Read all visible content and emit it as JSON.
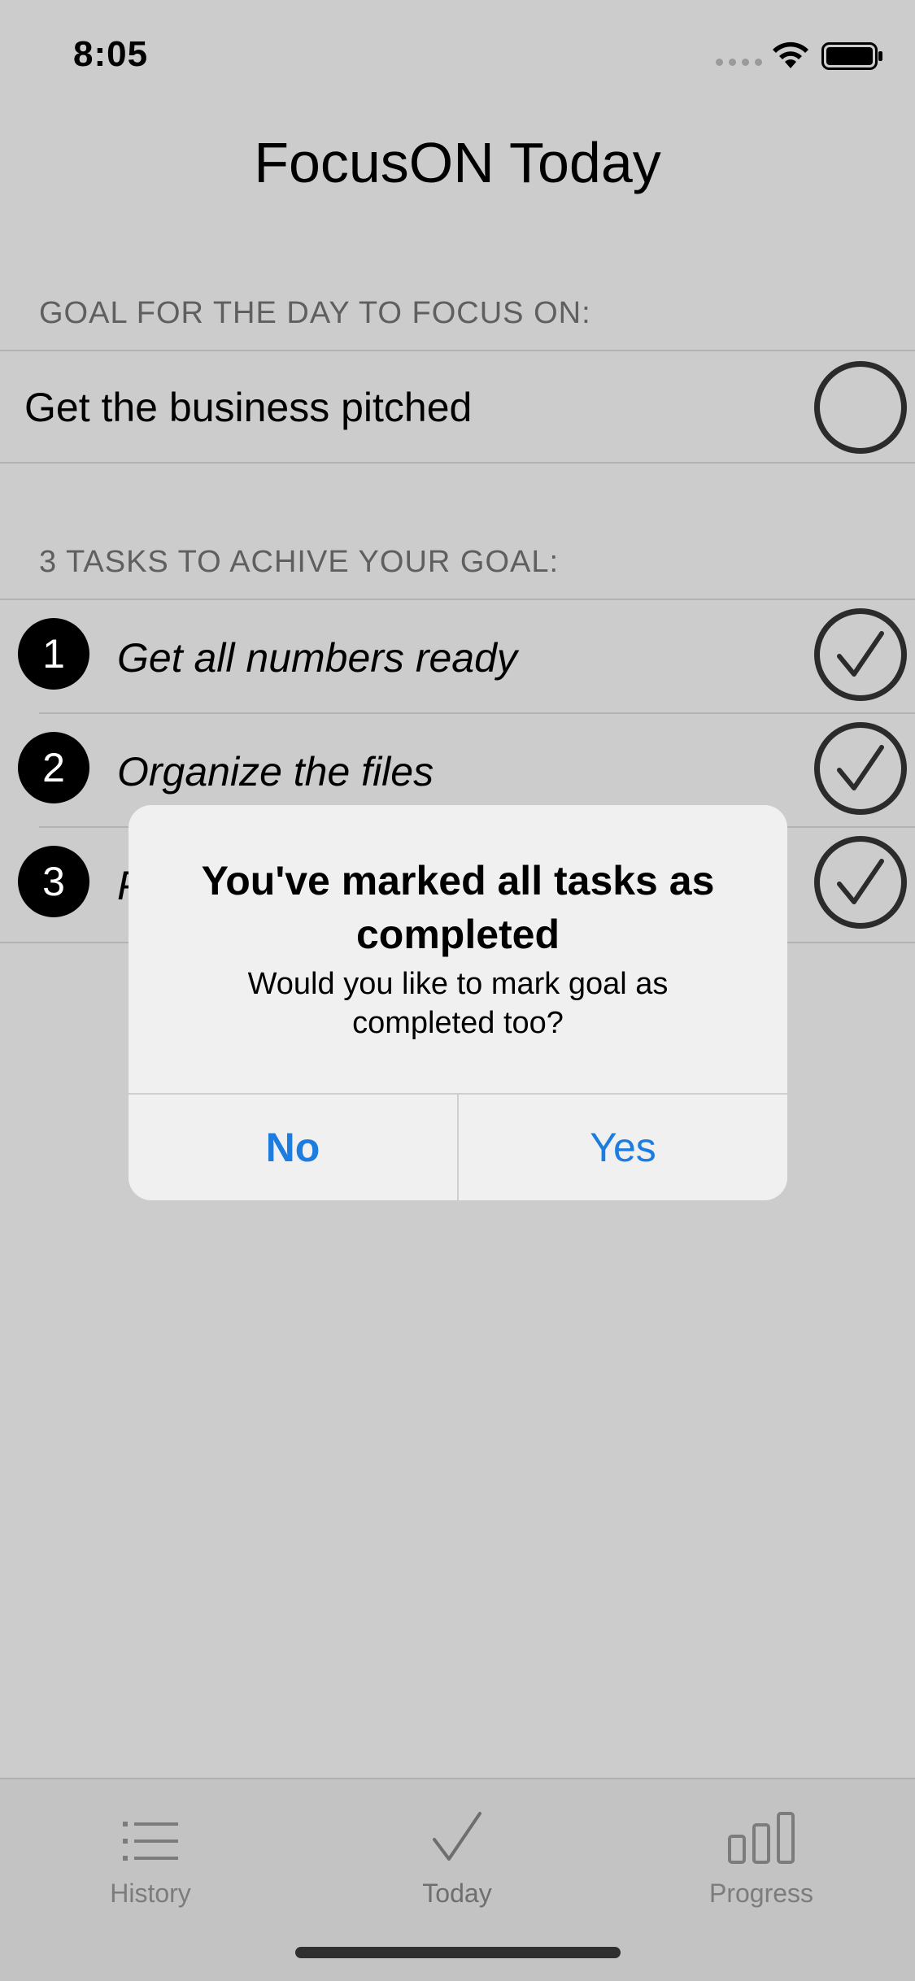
{
  "status_bar": {
    "time": "8:05"
  },
  "nav": {
    "title": "FocusON Today"
  },
  "goal_section": {
    "header": "GOAL FOR THE DAY TO FOCUS ON:",
    "goal": {
      "text": "Get the business pitched",
      "completed": false
    }
  },
  "tasks_section": {
    "header": "3 TASKS TO ACHIVE YOUR GOAL:",
    "tasks": [
      {
        "number": "1",
        "text": "Get all numbers ready",
        "completed": true
      },
      {
        "number": "2",
        "text": "Organize the files",
        "completed": true
      },
      {
        "number": "3",
        "text": "P",
        "completed": true
      }
    ]
  },
  "alert": {
    "title": "You've marked all tasks as completed",
    "message": "Would you like to mark goal as completed too?",
    "no_label": "No",
    "yes_label": "Yes",
    "button_color": "#1c7ce0"
  },
  "tab_bar": {
    "tabs": [
      {
        "label": "History",
        "icon": "list-icon"
      },
      {
        "label": "Today",
        "icon": "checkmark-icon",
        "selected": true
      },
      {
        "label": "Progress",
        "icon": "bar-chart-icon"
      }
    ]
  }
}
